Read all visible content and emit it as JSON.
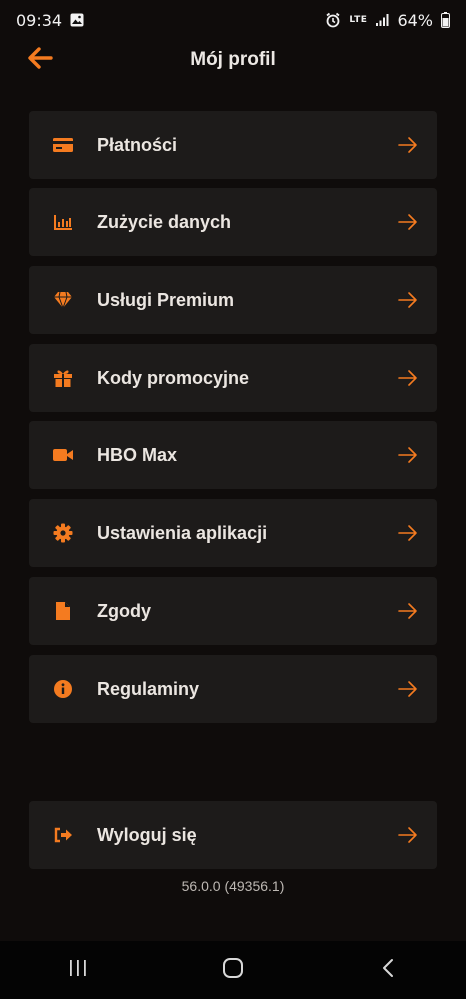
{
  "status_bar": {
    "time": "09:34",
    "network": "LTE",
    "battery": "64%"
  },
  "header": {
    "title": "Mój profil"
  },
  "menu": {
    "items": [
      {
        "label": "Płatności",
        "icon": "credit-card-icon"
      },
      {
        "label": "Zużycie danych",
        "icon": "bar-chart-icon"
      },
      {
        "label": "Usługi Premium",
        "icon": "diamond-icon"
      },
      {
        "label": "Kody promocyjne",
        "icon": "gift-icon"
      },
      {
        "label": "HBO Max",
        "icon": "video-camera-icon"
      },
      {
        "label": "Ustawienia aplikacji",
        "icon": "gear-icon"
      },
      {
        "label": "Zgody",
        "icon": "document-icon"
      },
      {
        "label": "Regulaminy",
        "icon": "info-icon"
      }
    ],
    "logout_label": "Wyloguj się",
    "logout_icon": "logout-icon"
  },
  "version": "56.0.0 (49356.1)",
  "colors": {
    "accent": "#f47b20",
    "background": "#0f0c0b",
    "card": "#1d1b1a"
  }
}
